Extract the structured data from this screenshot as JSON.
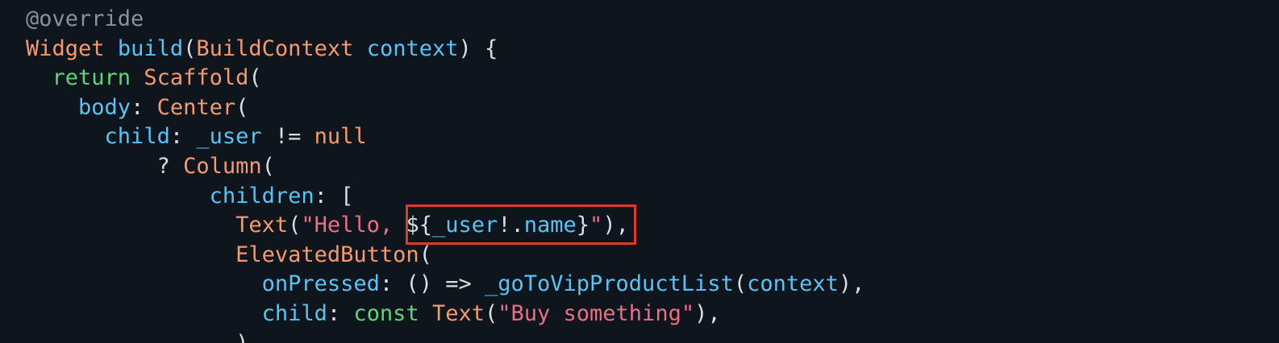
{
  "colors": {
    "background": "#0f151c",
    "annotation": "#8a9199",
    "type": "#f59a6e",
    "function": "#58c4f6",
    "keyword": "#5fd479",
    "punctuation": "#d8dee4",
    "string": "#ec6d86",
    "highlight_border": "#e2382a"
  },
  "highlight": {
    "label": "highlighted interpolation expression"
  },
  "code": [
    [
      {
        "t": "@override",
        "c": "annotation"
      }
    ],
    [
      {
        "t": "Widget",
        "c": "type"
      },
      {
        "t": " ",
        "c": "punctuation"
      },
      {
        "t": "build",
        "c": "function"
      },
      {
        "t": "(",
        "c": "punctuation"
      },
      {
        "t": "BuildContext",
        "c": "type"
      },
      {
        "t": " ",
        "c": "punctuation"
      },
      {
        "t": "context",
        "c": "function"
      },
      {
        "t": ") {",
        "c": "punctuation"
      }
    ],
    [
      {
        "t": "  ",
        "c": "punctuation"
      },
      {
        "t": "return",
        "c": "keyword"
      },
      {
        "t": " ",
        "c": "punctuation"
      },
      {
        "t": "Scaffold",
        "c": "type"
      },
      {
        "t": "(",
        "c": "punctuation"
      }
    ],
    [
      {
        "t": "    ",
        "c": "punctuation"
      },
      {
        "t": "body",
        "c": "function"
      },
      {
        "t": ": ",
        "c": "punctuation"
      },
      {
        "t": "Center",
        "c": "type"
      },
      {
        "t": "(",
        "c": "punctuation"
      }
    ],
    [
      {
        "t": "      ",
        "c": "punctuation"
      },
      {
        "t": "child",
        "c": "function"
      },
      {
        "t": ": ",
        "c": "punctuation"
      },
      {
        "t": "_user",
        "c": "function"
      },
      {
        "t": " != ",
        "c": "punctuation"
      },
      {
        "t": "null",
        "c": "type"
      }
    ],
    [
      {
        "t": "          ? ",
        "c": "punctuation"
      },
      {
        "t": "Column",
        "c": "type"
      },
      {
        "t": "(",
        "c": "punctuation"
      }
    ],
    [
      {
        "t": "              ",
        "c": "punctuation"
      },
      {
        "t": "children",
        "c": "function"
      },
      {
        "t": ": [",
        "c": "punctuation"
      }
    ],
    [
      {
        "t": "                ",
        "c": "punctuation"
      },
      {
        "t": "Text",
        "c": "type"
      },
      {
        "t": "(",
        "c": "punctuation"
      },
      {
        "t": "\"Hello, ",
        "c": "string"
      },
      {
        "t": "${",
        "c": "punctuation"
      },
      {
        "t": "_user",
        "c": "function"
      },
      {
        "t": "!.",
        "c": "punctuation"
      },
      {
        "t": "name",
        "c": "function"
      },
      {
        "t": "}",
        "c": "punctuation"
      },
      {
        "t": "\"",
        "c": "string"
      },
      {
        "t": "),",
        "c": "punctuation"
      }
    ],
    [
      {
        "t": "                ",
        "c": "punctuation"
      },
      {
        "t": "ElevatedButton",
        "c": "type"
      },
      {
        "t": "(",
        "c": "punctuation"
      }
    ],
    [
      {
        "t": "                  ",
        "c": "punctuation"
      },
      {
        "t": "onPressed",
        "c": "function"
      },
      {
        "t": ": () => ",
        "c": "punctuation"
      },
      {
        "t": "_goToVipProductList",
        "c": "function"
      },
      {
        "t": "(",
        "c": "punctuation"
      },
      {
        "t": "context",
        "c": "function"
      },
      {
        "t": "),",
        "c": "punctuation"
      }
    ],
    [
      {
        "t": "                  ",
        "c": "punctuation"
      },
      {
        "t": "child",
        "c": "function"
      },
      {
        "t": ": ",
        "c": "punctuation"
      },
      {
        "t": "const",
        "c": "keyword"
      },
      {
        "t": " ",
        "c": "punctuation"
      },
      {
        "t": "Text",
        "c": "type"
      },
      {
        "t": "(",
        "c": "punctuation"
      },
      {
        "t": "\"Buy something\"",
        "c": "string"
      },
      {
        "t": "),",
        "c": "punctuation"
      }
    ],
    [
      {
        "t": "                ),",
        "c": "punctuation"
      }
    ]
  ]
}
